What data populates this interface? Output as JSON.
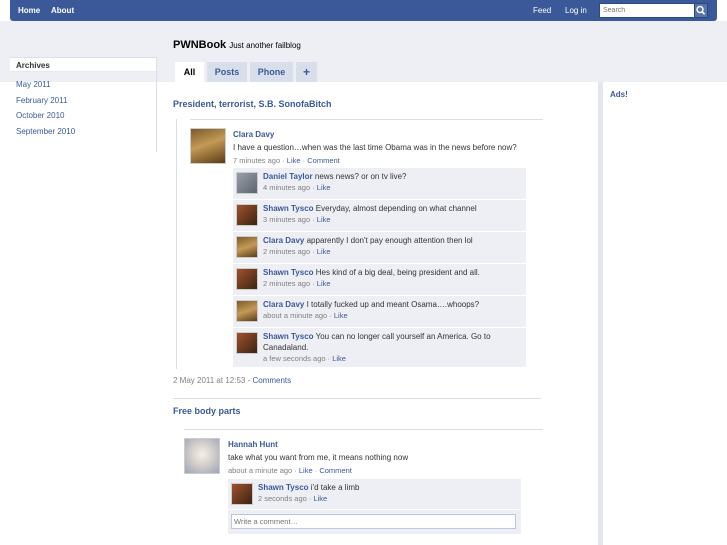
{
  "topbar": {
    "home": "Home",
    "about": "About",
    "feed": "Feed",
    "login": "Log in",
    "search_placeholder": "Search"
  },
  "header": {
    "site_name": "PWNBook",
    "tagline": "Just another failblog"
  },
  "tabs": [
    {
      "label": "All"
    },
    {
      "label": "Posts"
    },
    {
      "label": "Phone"
    },
    {
      "label": "+"
    }
  ],
  "sidebar": {
    "title": "Archives",
    "links": [
      "May 2011",
      "February 2011",
      "October 2010",
      "September 2010"
    ]
  },
  "ads": {
    "title": "Ads!"
  },
  "posts": [
    {
      "title": "President, terrorist, S.B. SonofaBitch",
      "author": "Clara Davy",
      "text": "I have a question…when was the last time Obama was in the news before now?",
      "time": "7 minutes ago",
      "like": "Like",
      "comment": "Comment",
      "comments": [
        {
          "name": "Daniel Taylor",
          "text": "news news? or on tv live?",
          "time": "4 minutes ago",
          "like": "Like"
        },
        {
          "name": "Shawn Tysco",
          "text": "Everyday, almost depending on what channel",
          "time": "3 minutes ago",
          "like": "Like"
        },
        {
          "name": "Clara Davy",
          "text": "apparently I don't pay enough attention then lol",
          "time": "2 minutes ago",
          "like": "Like"
        },
        {
          "name": "Shawn Tysco",
          "text": "Hes kind of a big deal, being president and all.",
          "time": "2 minutes ago",
          "like": "Like"
        },
        {
          "name": "Clara Davy",
          "text": "I totally fucked up and meant Osama….whoops?",
          "time": "about a minute ago",
          "like": "Like"
        },
        {
          "name": "Shawn Tysco",
          "text": "You can no longer call yourself an America. Go to Canadaland.",
          "time": "a few seconds ago",
          "like": "Like"
        }
      ],
      "footer_date": "2 May 2011 at 12:53",
      "footer_sep": " - ",
      "footer_link": "Comments"
    },
    {
      "title": "Free body parts",
      "author": "Hannah Hunt",
      "text": "take what you want from me, it means nothing now",
      "time": "about a minute ago",
      "like": "Like",
      "comment": "Comment",
      "comments": [
        {
          "name": "Shawn Tysco",
          "text": "i'd take a limb",
          "time": "2 seconds ago",
          "like": "Like"
        }
      ],
      "write_placeholder": "Write a comment…"
    }
  ],
  "sep": " · ",
  "colors": {
    "brand": "#3b5998",
    "band": "#edeff4",
    "comment_bg": "#edeff4"
  }
}
